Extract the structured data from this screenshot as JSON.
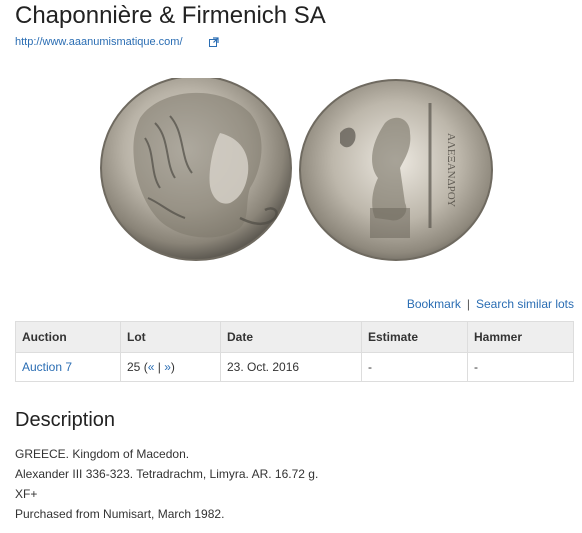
{
  "header": {
    "title": "Chaponnière & Firmenich SA",
    "website": "http://www.aaanumismatique.com/"
  },
  "image": {
    "coin_obverse_icon": "coin-obverse-herakles-icon",
    "coin_reverse_icon": "coin-reverse-zeus-icon"
  },
  "actions": {
    "bookmark": "Bookmark",
    "separator": "|",
    "search_similar": "Search similar lots"
  },
  "table": {
    "headers": {
      "auction": "Auction",
      "lot": "Lot",
      "date": "Date",
      "estimate": "Estimate",
      "hammer": "Hammer"
    },
    "row": {
      "auction": "Auction 7",
      "lot_number": "25",
      "lot_open": "(",
      "prev": "«",
      "lot_sep": "|",
      "next": "»",
      "lot_close": ")",
      "date": "23. Oct. 2016",
      "estimate": "-",
      "hammer": "-"
    }
  },
  "description": {
    "title": "Description",
    "lines": [
      "GREECE. Kingdom of Macedon.",
      "Alexander III 336-323. Tetradrachm, Limyra. AR. 16.72 g.",
      "XF+",
      "Purchased from Numisart, March 1982."
    ]
  }
}
